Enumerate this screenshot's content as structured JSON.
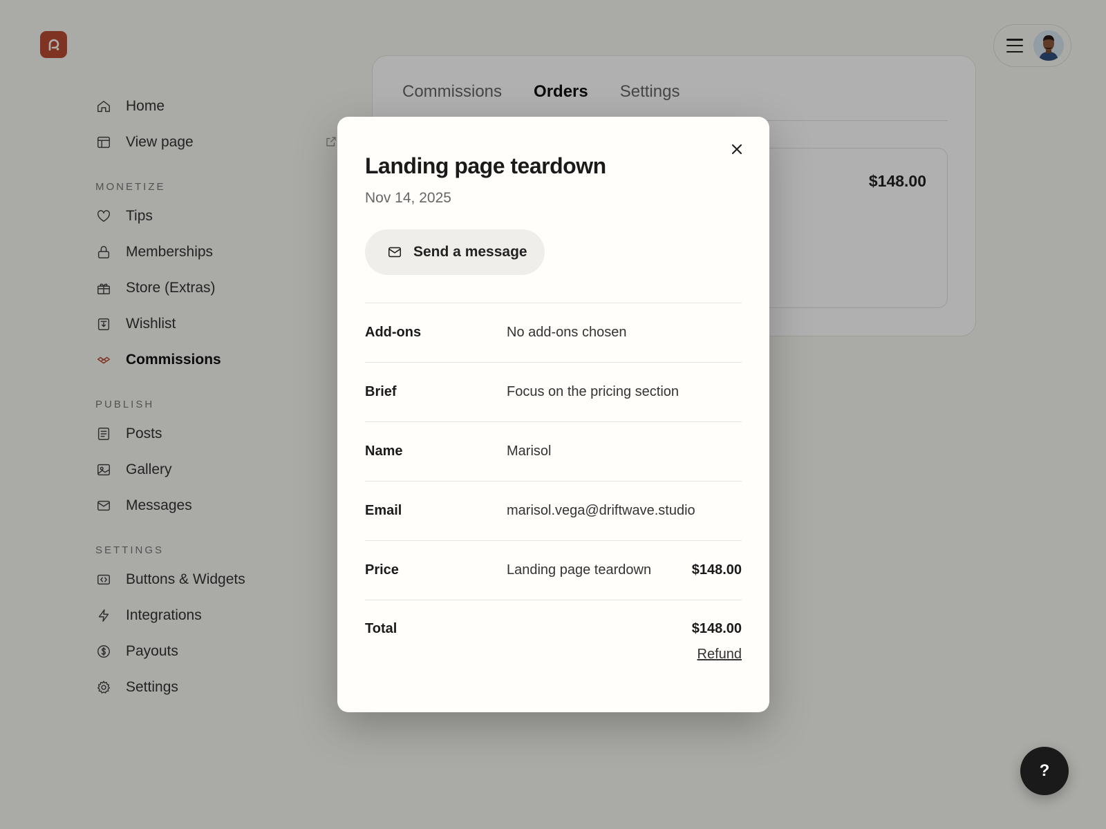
{
  "sidebar": {
    "top_items": [
      {
        "label": "Home",
        "icon": "home-icon"
      },
      {
        "label": "View page",
        "icon": "layout-icon"
      }
    ],
    "sections": [
      {
        "label": "MONETIZE",
        "items": [
          {
            "label": "Tips",
            "icon": "heart-icon"
          },
          {
            "label": "Memberships",
            "icon": "lock-icon"
          },
          {
            "label": "Store (Extras)",
            "icon": "gift-icon"
          },
          {
            "label": "Wishlist",
            "icon": "wishlist-icon"
          },
          {
            "label": "Commissions",
            "icon": "handshake-icon",
            "active": true
          }
        ]
      },
      {
        "label": "PUBLISH",
        "items": [
          {
            "label": "Posts",
            "icon": "document-icon"
          },
          {
            "label": "Gallery",
            "icon": "image-icon"
          },
          {
            "label": "Messages",
            "icon": "mail-icon"
          }
        ]
      },
      {
        "label": "SETTINGS",
        "items": [
          {
            "label": "Buttons & Widgets",
            "icon": "code-icon"
          },
          {
            "label": "Integrations",
            "icon": "bolt-icon"
          },
          {
            "label": "Payouts",
            "icon": "dollar-icon"
          },
          {
            "label": "Settings",
            "icon": "gear-icon"
          }
        ]
      }
    ]
  },
  "tabs": [
    "Commissions",
    "Orders",
    "Settings"
  ],
  "active_tab": "Orders",
  "order_card": {
    "price": "$148.00"
  },
  "modal": {
    "title": "Landing page teardown",
    "date": "Nov 14, 2025",
    "send_button": "Send a message",
    "rows": {
      "addons": {
        "label": "Add-ons",
        "value": "No add-ons chosen"
      },
      "brief": {
        "label": "Brief",
        "value": "Focus on the pricing section"
      },
      "name": {
        "label": "Name",
        "value": "Marisol"
      },
      "email": {
        "label": "Email",
        "value": "marisol.vega@driftwave.studio"
      },
      "price": {
        "label": "Price",
        "value": "Landing page teardown",
        "amount": "$148.00"
      },
      "total": {
        "label": "Total",
        "amount": "$148.00"
      }
    },
    "refund_label": "Refund"
  },
  "help_label": "?",
  "colors": {
    "accent": "#b84a32",
    "overlay": "rgba(0,0,0,0.31)",
    "background": "#f7f6f2"
  }
}
